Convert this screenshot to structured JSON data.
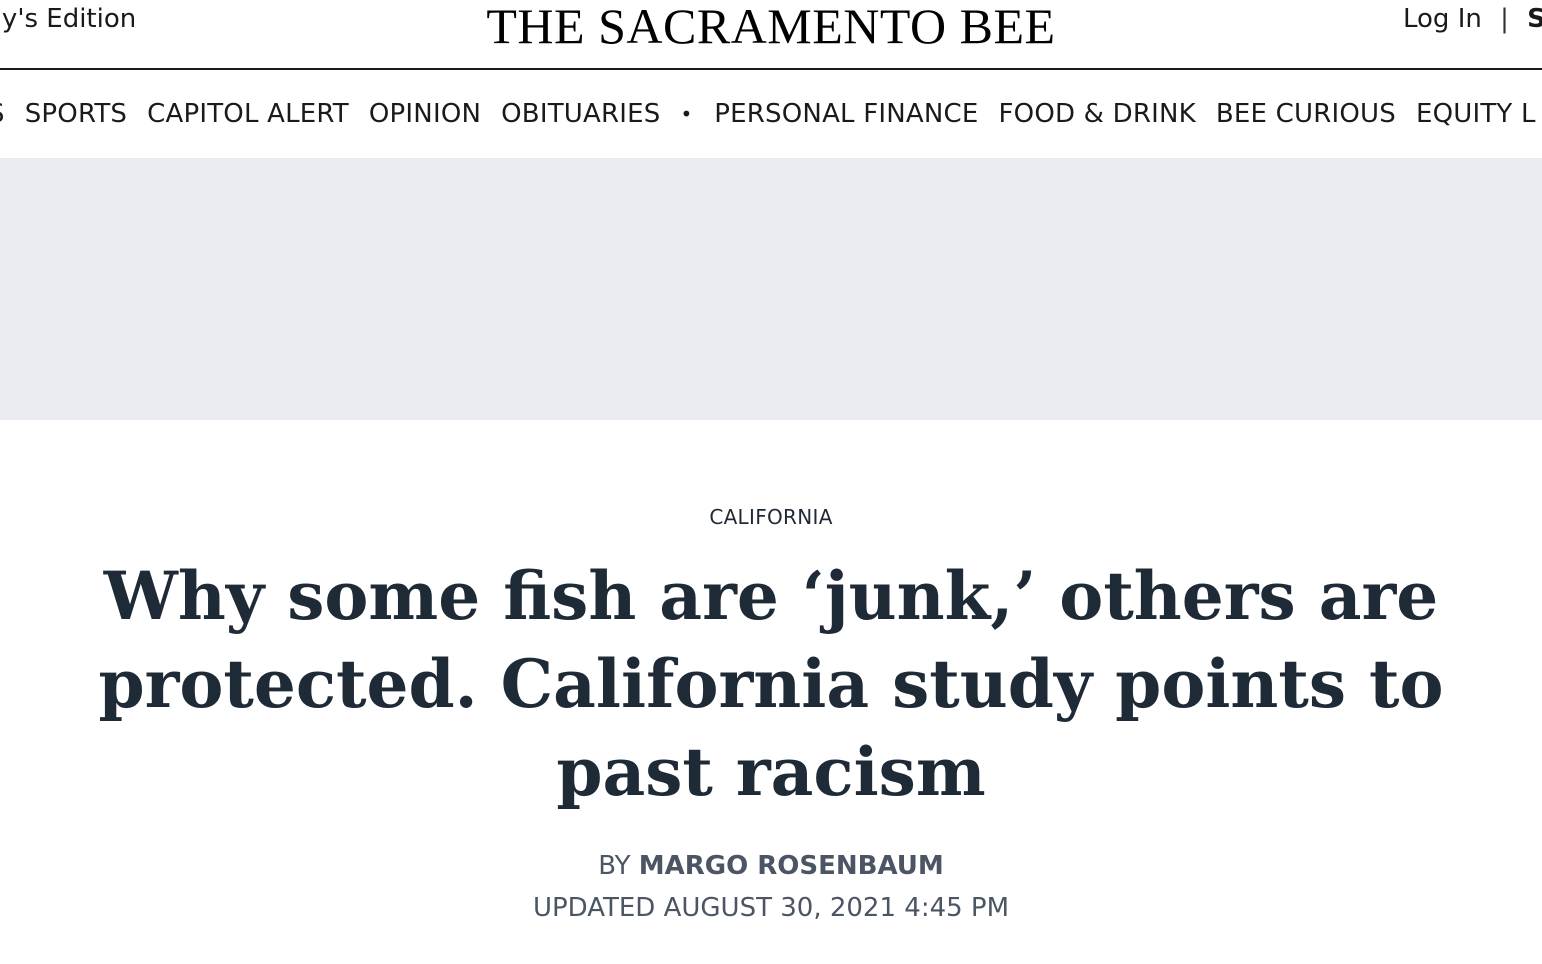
{
  "header": {
    "edition_label": "ay's Edition",
    "logo_text": "THE SACRAMENTO BEE",
    "login_label": "Log In",
    "separator": "|",
    "subscribe_label": "Su"
  },
  "nav": {
    "items": [
      {
        "label": "S"
      },
      {
        "label": "SPORTS"
      },
      {
        "label": "CAPITOL ALERT"
      },
      {
        "label": "OPINION"
      },
      {
        "label": "OBITUARIES"
      },
      {
        "label": "PERSONAL FINANCE"
      },
      {
        "label": "FOOD & DRINK"
      },
      {
        "label": "BEE CURIOUS"
      },
      {
        "label": "EQUITY L"
      }
    ],
    "dot": "•"
  },
  "ad": {},
  "article": {
    "section": "CALIFORNIA",
    "headline": "Why some fish are ‘junk,’ others are protected. California study points to past racism",
    "byline_prefix": "BY",
    "author": "MARGO ROSENBAUM",
    "updated": "UPDATED AUGUST 30, 2021 4:45 PM"
  },
  "colors": {
    "text_dark": "#1f2a37",
    "byline_gray": "#4b5563",
    "ad_background": "#e8ebf0",
    "rule": "#1a1a1a"
  }
}
